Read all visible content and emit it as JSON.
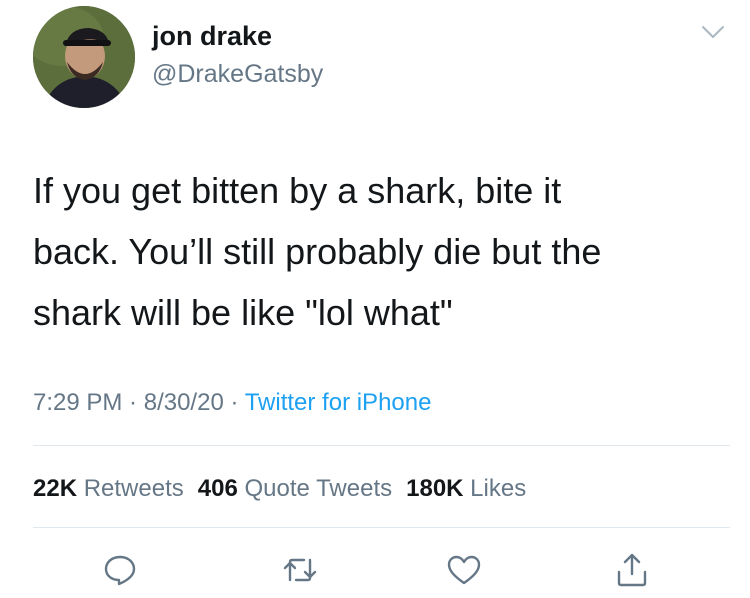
{
  "user": {
    "display_name": "jon drake",
    "handle": "@DrakeGatsby"
  },
  "tweet": {
    "lines": [
      "If you get bitten by a shark, bite it",
      "back. You’ll still probably die but the",
      "shark will be like \"lol what\""
    ]
  },
  "meta": {
    "time": "7:29 PM",
    "sep1": " · ",
    "date": "8/30/20",
    "sep2": " · ",
    "source": "Twitter for iPhone"
  },
  "stats": {
    "retweets_count": "22K",
    "retweets_label": "Retweets",
    "quote_count": "406",
    "quote_label": "Quote Tweets",
    "likes_count": "180K",
    "likes_label": "Likes"
  },
  "icons": {
    "caret": "chevron-down-icon",
    "reply": "reply-icon",
    "retweet": "retweet-icon",
    "like": "heart-icon",
    "share": "share-icon"
  },
  "colors": {
    "text": "#14171a",
    "secondary": "#657786",
    "link": "#1da1f2",
    "divider": "#e1e8ed"
  }
}
